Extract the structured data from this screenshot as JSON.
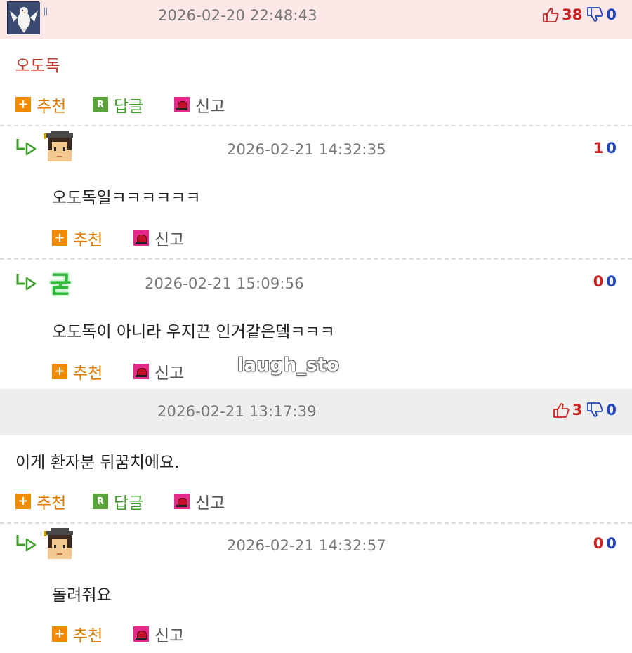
{
  "comments": [
    {
      "timestamp": "2026-02-20 22:48:43",
      "up": "38",
      "down": "0",
      "body": "오도독",
      "actions": {
        "recommend": "추천",
        "reply": "답글",
        "report": "신고"
      },
      "avatar_icon": "dove-icon",
      "colors": {
        "header_bg": "#fde7e7",
        "body_text": "#c0392b"
      }
    },
    {
      "timestamp": "2026-02-21 14:32:35",
      "up": "1",
      "down": "0",
      "body": "오도독일ㅋㅋㅋㅋㅋㅋ",
      "actions": {
        "recommend": "추천",
        "report": "신고"
      },
      "avatar_icon": "graduate-pixel-icon"
    },
    {
      "timestamp": "2026-02-21 15:09:56",
      "up": "0",
      "down": "0",
      "body": "오도독이 아니라 우지끈 인거같은뎈ㅋㅋㅋ",
      "actions": {
        "recommend": "추천",
        "report": "신고"
      },
      "avatar_icon": "green-glyph-icon",
      "avatar_glyph": "굳"
    },
    {
      "timestamp": "2026-02-21 13:17:39",
      "up": "3",
      "down": "0",
      "body": "이게 환자분 뒤꿈치에요.",
      "actions": {
        "recommend": "추천",
        "reply": "답글",
        "report": "신고"
      },
      "colors": {
        "header_bg": "#eeeeee"
      }
    },
    {
      "timestamp": "2026-02-21 14:32:57",
      "up": "0",
      "down": "0",
      "body": "돌려줘요",
      "actions": {
        "recommend": "추천",
        "report": "신고"
      },
      "avatar_icon": "graduate-pixel-icon"
    }
  ],
  "watermark": "laugh_sto",
  "colors": {
    "recommend": "#e07b00",
    "reply": "#3f9e27",
    "up": "#cc2222",
    "down": "#1f45b8"
  }
}
